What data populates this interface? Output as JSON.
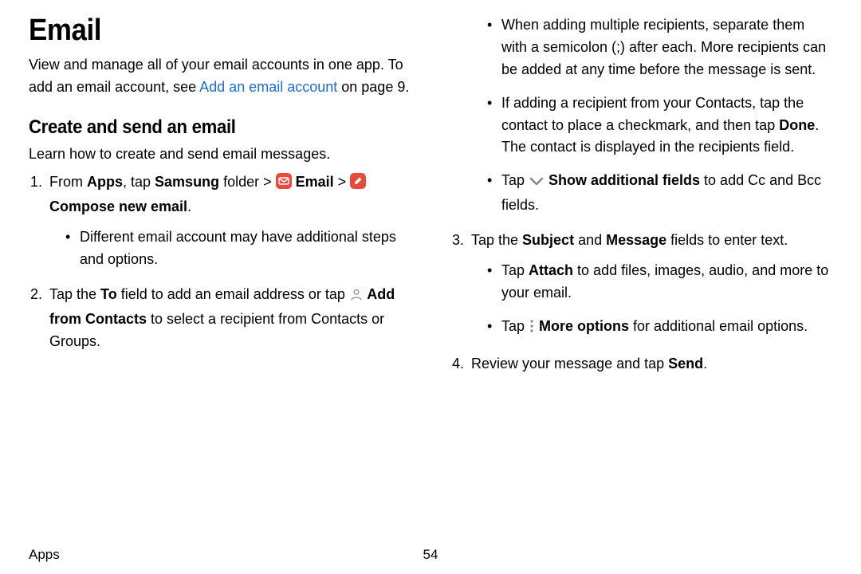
{
  "title": "Email",
  "intro_pre": "View and manage all of your email accounts in one app. To add an email account, see ",
  "intro_link": "Add an email account",
  "intro_post": " on page 9.",
  "section_heading": "Create and send an email",
  "section_lead": "Learn how to create and send email messages.",
  "step1": {
    "pre": "From ",
    "apps": "Apps",
    "mid1": ", tap ",
    "samsung": "Samsung",
    "mid2": " folder > ",
    "email": " Email",
    "mid3": " > ",
    "compose": " Compose new email",
    "post": ".",
    "bullet1": "Different email account may have additional steps and options."
  },
  "step2": {
    "pre": "Tap the ",
    "to": "To",
    "mid1": " field to add an email address or tap ",
    "addfrom": " Add from Contacts",
    "post": " to select a recipient from Contacts or Groups.",
    "bullet1": "When adding multiple recipients, separate them with a semicolon (;) after each. More recipients can be added at any time before the message is sent.",
    "bullet2_pre": "If adding a recipient from your Contacts, tap the contact to place a checkmark, and then tap ",
    "bullet2_done": "Done",
    "bullet2_post": ". The contact is displayed in the recipients field.",
    "bullet3_pre": "Tap ",
    "bullet3_label": " Show additional fields",
    "bullet3_post": " to add Cc and Bcc fields."
  },
  "step3": {
    "pre": "Tap the ",
    "subject": "Subject",
    "mid1": " and ",
    "message": "Message",
    "post": " fields to enter text.",
    "bullet1_pre": "Tap ",
    "bullet1_attach": "Attach",
    "bullet1_post": " to add files, images, audio, and more to your email.",
    "bullet2_pre": "Tap ",
    "bullet2_more": " More options",
    "bullet2_post": " for additional email options."
  },
  "step4": {
    "pre": "Review your message and tap ",
    "send": "Send",
    "post": "."
  },
  "footer": {
    "section": "Apps",
    "page": "54"
  }
}
